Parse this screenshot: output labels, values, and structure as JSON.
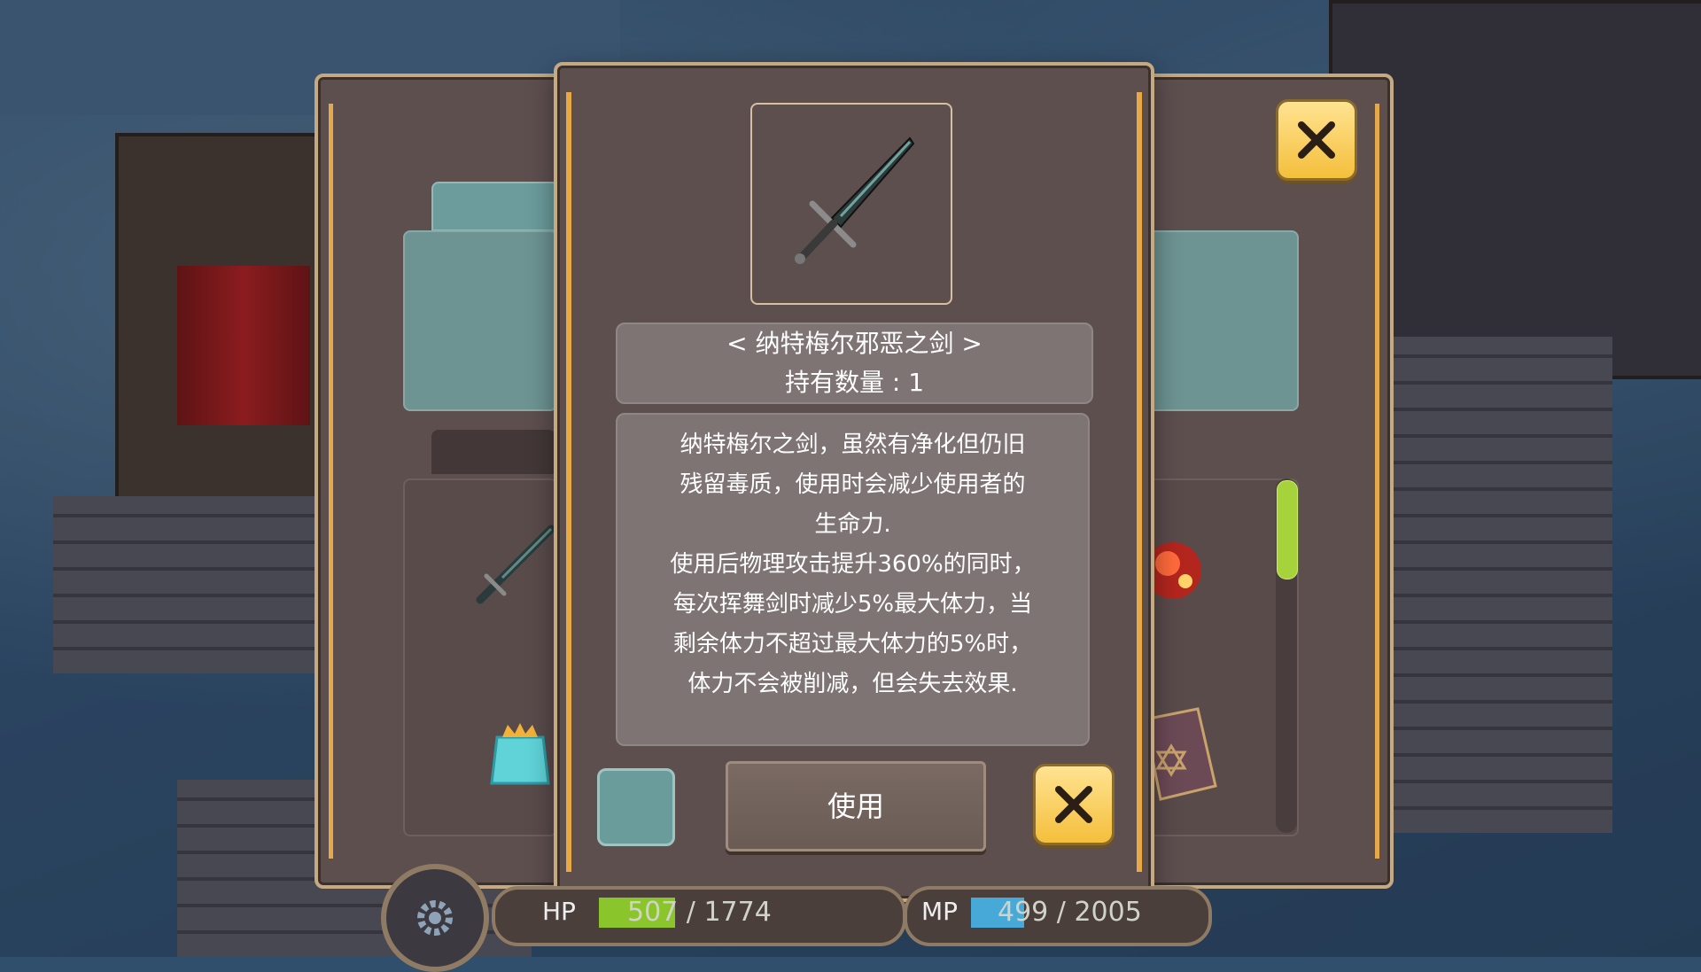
{
  "item": {
    "name": "< 纳特梅尔邪恶之剑 >",
    "quantity": "持有数量 : 1",
    "description_lines": [
      "纳特梅尔之剑，虽然有净化但仍旧",
      "残留毒质，使用时会减少使用者的",
      "生命力.",
      "使用后物理攻击提升360%的同时，",
      "每次挥舞剑时减少5%最大体力，当",
      "剩余体力不超过最大体力的5%时，",
      "体力不会被削减，但会失去效果."
    ],
    "icon": "sword-icon"
  },
  "buttons": {
    "use_label": "使用",
    "close_icon": "close-icon"
  },
  "hud": {
    "hp_label": "HP",
    "hp_value": "507 / 1774",
    "hp_current": 507,
    "hp_max": 1774,
    "mp_label": "MP",
    "mp_value": "499 / 2005",
    "mp_current": 499,
    "mp_max": 2005,
    "settings_icon": "gear-icon"
  },
  "colors": {
    "hp": "#8bc52c",
    "mp": "#46a9d8",
    "accent_gold": "#e8a945",
    "close_button": "#f4bf3c",
    "scrollbar": "#a6d23b"
  }
}
